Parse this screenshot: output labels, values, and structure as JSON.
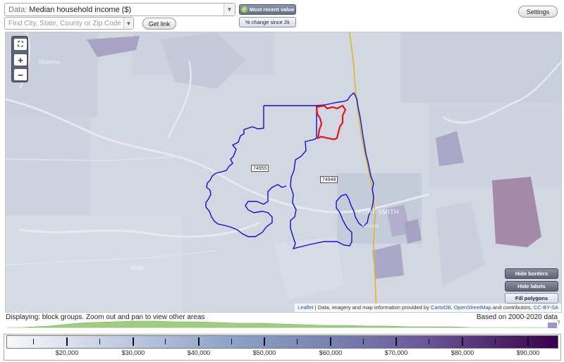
{
  "controls": {
    "data_label": "Data:",
    "data_value": "Median household income ($)",
    "find_placeholder": "Find City, State, County or Zip Code",
    "get_link": "Get link",
    "settings": "Settings",
    "most_recent": "Most recent value",
    "pct_change": "% change since 2k"
  },
  "map": {
    "zoom_in": "+",
    "zoom_out": "−",
    "hide_borders": "Hide borders",
    "hide_labels": "Hide labels",
    "fill_polygons": "Fill polygons",
    "zip_labels": [
      "74955",
      "74948"
    ],
    "places": {
      "muldrow": "Muldrow",
      "fort_smith": "FORT SMITH",
      "arkoma": "Arkoma",
      "bigler": "Bigler"
    },
    "attribution": {
      "leaflet": "Leaflet",
      "middle": " | Data, imagery and map information provided by ",
      "carto": "CartoDB",
      "comma": ", ",
      "osm": "OpenStreetMap",
      "end": " and contributors, ",
      "license": "CC-BY-SA"
    }
  },
  "footer": {
    "displaying": "Displaying: block groups. Zoom out and pan to view other areas",
    "based_on": "Based on 2000-2020 data",
    "qmark": "?"
  },
  "legend": {
    "labels": [
      "$20,000",
      "$30,000",
      "$40,000",
      "$50,000",
      "$60,000",
      "$70,000",
      "$80,000",
      "$90,000"
    ]
  },
  "colors": {
    "border_blue": "#1010d0",
    "border_red": "#e8141a",
    "state_line": "#e2b21c"
  }
}
